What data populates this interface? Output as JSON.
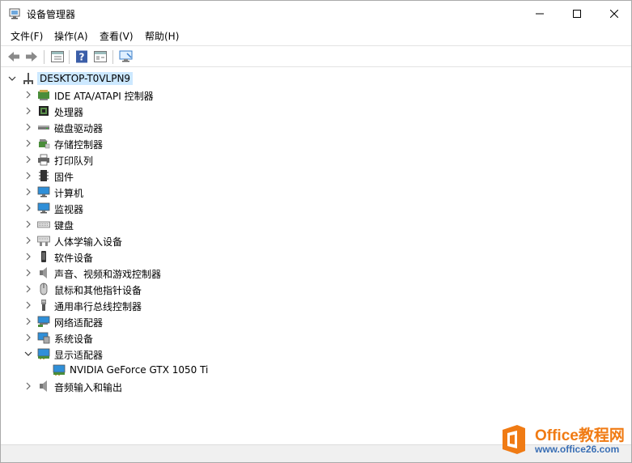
{
  "window": {
    "title": "设备管理器",
    "controls": {
      "minimize": "minimize",
      "maximize": "maximize",
      "close": "close"
    }
  },
  "menu": [
    "文件(F)",
    "操作(A)",
    "查看(V)",
    "帮助(H)"
  ],
  "toolbar": {
    "buttons": [
      "back-arrow-icon",
      "forward-arrow-icon",
      "properties-icon",
      "help-icon",
      "view-icon",
      "monitor-scan-icon"
    ]
  },
  "tree": {
    "root": {
      "label": "DESKTOP-T0VLPN9",
      "expanded": true
    },
    "categories": [
      {
        "label": "IDE ATA/ATAPI 控制器",
        "icon": "ide-controller-icon",
        "expanded": false
      },
      {
        "label": "处理器",
        "icon": "processor-icon",
        "expanded": false
      },
      {
        "label": "磁盘驱动器",
        "icon": "disk-drive-icon",
        "expanded": false
      },
      {
        "label": "存储控制器",
        "icon": "storage-controller-icon",
        "expanded": false
      },
      {
        "label": "打印队列",
        "icon": "printer-icon",
        "expanded": false
      },
      {
        "label": "固件",
        "icon": "firmware-icon",
        "expanded": false
      },
      {
        "label": "计算机",
        "icon": "computer-icon",
        "expanded": false
      },
      {
        "label": "监视器",
        "icon": "monitor-icon",
        "expanded": false
      },
      {
        "label": "键盘",
        "icon": "keyboard-icon",
        "expanded": false
      },
      {
        "label": "人体学输入设备",
        "icon": "hid-icon",
        "expanded": false
      },
      {
        "label": "软件设备",
        "icon": "software-device-icon",
        "expanded": false
      },
      {
        "label": "声音、视频和游戏控制器",
        "icon": "speaker-icon",
        "expanded": false
      },
      {
        "label": "鼠标和其他指针设备",
        "icon": "mouse-icon",
        "expanded": false
      },
      {
        "label": "通用串行总线控制器",
        "icon": "usb-icon",
        "expanded": false
      },
      {
        "label": "网络适配器",
        "icon": "network-adapter-icon",
        "expanded": false
      },
      {
        "label": "系统设备",
        "icon": "system-device-icon",
        "expanded": false
      },
      {
        "label": "显示适配器",
        "icon": "display-adapter-icon",
        "expanded": true,
        "children": [
          {
            "label": "NVIDIA GeForce GTX 1050 Ti",
            "icon": "display-adapter-icon"
          }
        ]
      },
      {
        "label": "音频输入和输出",
        "icon": "speaker-icon",
        "expanded": false
      }
    ]
  },
  "watermark": {
    "title": "Office教程网",
    "url": "www.office26.com"
  },
  "colors": {
    "selection": "#cce8ff",
    "accent": "#f07b14",
    "url": "#3a6fb5"
  }
}
